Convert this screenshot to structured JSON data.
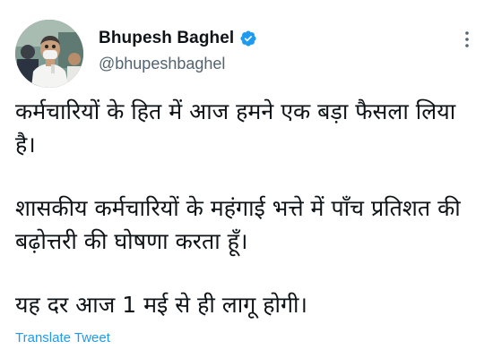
{
  "author": {
    "display_name": "Bhupesh Baghel",
    "handle": "@bhupeshbaghel",
    "verified": true,
    "verified_color": "#1d9bf0"
  },
  "tweet": {
    "paragraphs": [
      "कर्मचारियों के हित में आज हमने एक बड़ा फैसला लिया है।",
      "शासकीय कर्मचारियों के महंगाई भत्ते में पाँच प्रतिशत की बढ़ोत्तरी की घोषणा करता हूँ।",
      "यह दर आज 1 मई से ही लागू होगी।"
    ]
  },
  "actions": {
    "translate_label": "Translate Tweet",
    "more_icon": "more-options-icon"
  },
  "colors": {
    "text": "#0f1419",
    "secondary": "#536471",
    "link": "#1d9bf0"
  }
}
